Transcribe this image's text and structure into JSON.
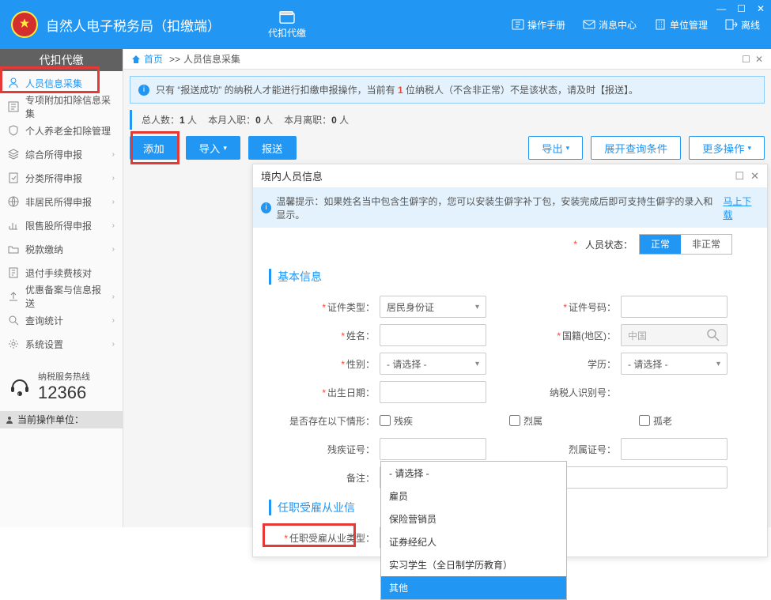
{
  "window": {
    "min": "—",
    "max": "☐",
    "close": "✕"
  },
  "header": {
    "title": "自然人电子税务局（扣缴端）",
    "daikou": "代扣代缴",
    "actions": {
      "manual": "操作手册",
      "msg": "消息中心",
      "unit": "单位管理",
      "offline": "离线"
    }
  },
  "sidebar": {
    "head": "代扣代缴",
    "items": {
      "collect": "人员信息采集",
      "addition": "专项附加扣除信息采集",
      "pension": "个人养老金扣除管理",
      "combine": "综合所得申报",
      "classify": "分类所得申报",
      "nonres": "非居民所得申报",
      "restrict": "限售股所得申报",
      "tax": "税款缴纳",
      "refund": "退付手续费核对",
      "backup": "优惠备案与信息报送",
      "query": "查询统计",
      "setting": "系统设置"
    },
    "hotline_label": "纳税服务热线",
    "hotline_num": "12366",
    "current_unit_label": "当前操作单位："
  },
  "crumb": {
    "home": "首页",
    "sep": ">>",
    "page": "人员信息采集",
    "min": "☐",
    "close": "✕"
  },
  "alert": {
    "p1": "只有 “报送成功” 的纳税人才能进行扣缴申报操作，当前有",
    "count": "1",
    "p2": "位纳税人（不含非正常）不是该状态，请及时【报送】。"
  },
  "stats": {
    "total_l": "总人数：",
    "total_v": "1",
    "total_u": "人",
    "in_l": "本月入职：",
    "in_v": "0",
    "in_u": "人",
    "out_l": "本月离职：",
    "out_v": "0",
    "out_u": "人"
  },
  "toolbar": {
    "add": "添加",
    "import": "导入",
    "send": "报送",
    "export": "导出",
    "expand": "展开查询条件",
    "more": "更多操作"
  },
  "dialog": {
    "title": "境内人员信息",
    "tip_pre": "温馨提示：如果姓名当中包含生僻字的，您可以安装生僻字补丁包，安装完成后即可支持生僻字的录入和显示。",
    "tip_link": "马上下载",
    "status_label": "人员状态：",
    "status_normal": "正常",
    "status_abnormal": "非正常",
    "sec_basic": "基本信息",
    "sec_employ": "任职受雇从业信",
    "fields": {
      "id_type": "证件类型：",
      "id_type_v": "居民身份证",
      "id_no": "证件号码：",
      "name": "姓名：",
      "nation": "国籍(地区)：",
      "nation_v": "中国",
      "gender": "性别：",
      "gender_v": "- 请选择 -",
      "edu": "学历：",
      "edu_v": "- 请选择 -",
      "birth": "出生日期：",
      "taxid": "纳税人识别号：",
      "exist": "是否存在以下情形：",
      "chk_dis": "残疾",
      "chk_mar": "烈属",
      "chk_orp": "孤老",
      "dis_no": "残疾证号：",
      "mar_no": "烈属证号：",
      "remark": "备注：",
      "employ_type": "任职受雇从业类型：",
      "employ_type_v": "其他"
    },
    "options": {
      "o0": "- 请选择 -",
      "o1": "雇员",
      "o2": "保险营销员",
      "o3": "证券经纪人",
      "o4": "实习学生（全日制学历教育）",
      "o5": "其他"
    }
  }
}
